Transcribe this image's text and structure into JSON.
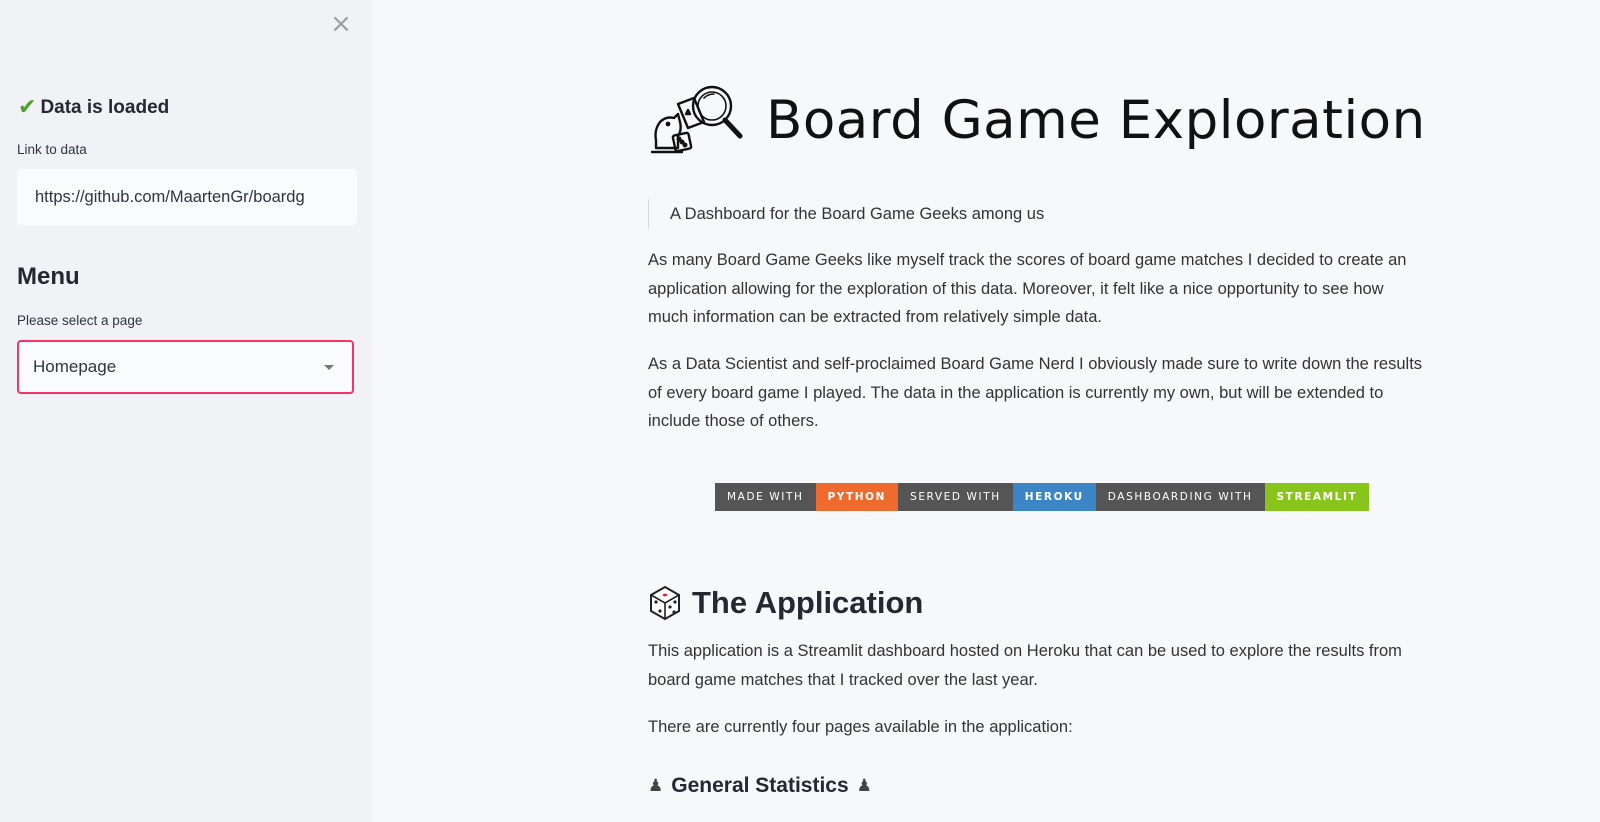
{
  "sidebar": {
    "close_label": "×",
    "status_text": "Data is loaded",
    "status_icon": "check-icon",
    "link_label": "Link to data",
    "link_value": "https://github.com/MaartenGr/boardg",
    "menu_title": "Menu",
    "select_label": "Please select a page",
    "select_value": "Homepage"
  },
  "main": {
    "title": "Board Game Exploration",
    "quote": "A Dashboard for the Board Game Geeks among us",
    "para1": "As many Board Game Geeks like myself track the scores of board game matches I decided to create an application allowing for the exploration of this data. Moreover, it felt like a nice opportunity to see how much information can be extracted from relatively simple data.",
    "para2": "As a Data Scientist and self-proclaimed Board Game Nerd I obviously made sure to write down the results of every board game I played. The data in the application is currently my own, but will be extended to include those of others.",
    "badges": [
      {
        "label": "MADE WITH",
        "value": "PYTHON"
      },
      {
        "label": "SERVED WITH",
        "value": "HEROKU"
      },
      {
        "label": "DASHBOARDING WITH",
        "value": "STREAMLIT"
      }
    ],
    "section_title": "The Application",
    "para3": "This application is a Streamlit dashboard hosted on Heroku that can be used to explore the results from board game matches that I tracked over the last year.",
    "para4": "There are currently four pages available in the application:",
    "sub_title": "General Statistics"
  },
  "colors": {
    "accent": "#f63366",
    "python": "#ef6a2d",
    "heroku": "#3c85c6",
    "streamlit": "#88c51a",
    "badge_label": "#555555"
  }
}
